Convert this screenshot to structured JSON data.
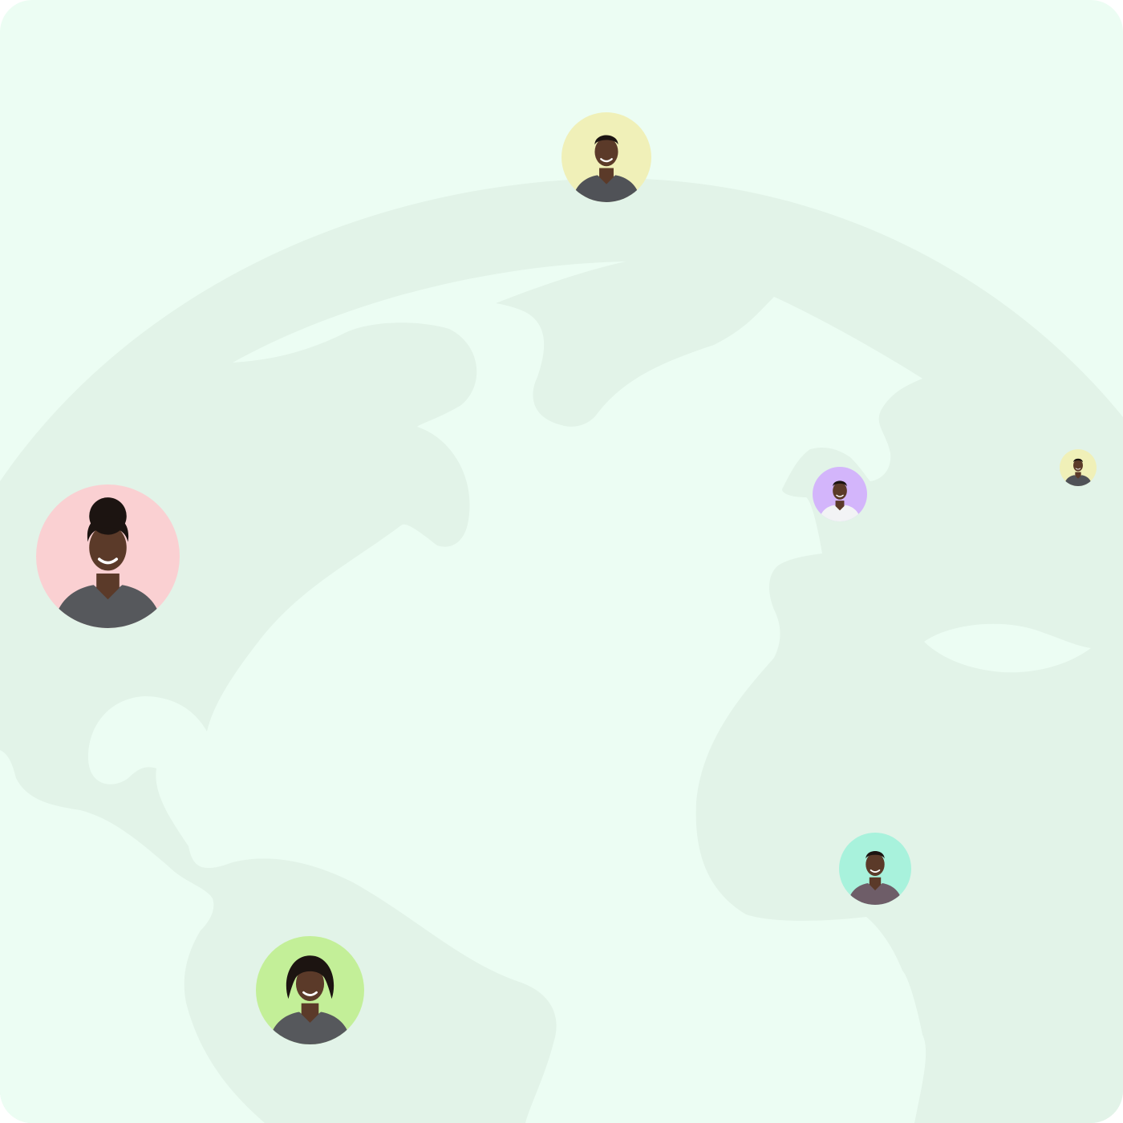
{
  "colors": {
    "background": "#ecfdf3",
    "land": "#e2f3e8",
    "skin": "#5b3a29",
    "hair": "#1c1411",
    "shirt_gray": "#505257",
    "shirt_white": "#f2f3f5",
    "shirt_pattern": "#6e5d68"
  },
  "avatars": [
    {
      "id": "person-top-center",
      "background": "#f0f0b8",
      "shirt": "#505257",
      "hair": "short"
    },
    {
      "id": "person-left",
      "background": "#fad0d2",
      "shirt": "#56585c",
      "hair": "puff"
    },
    {
      "id": "person-center-right",
      "background": "#d3b5fb",
      "shirt": "#f2f3f5",
      "hair": "short"
    },
    {
      "id": "person-far-right",
      "background": "#f0f0b8",
      "shirt": "#505257",
      "hair": "short"
    },
    {
      "id": "person-bottom-right",
      "background": "#a8f2dc",
      "shirt": "#6e5d68",
      "hair": "short"
    },
    {
      "id": "person-bottom-left",
      "background": "#c3ef98",
      "shirt": "#56585c",
      "hair": "locs"
    }
  ]
}
